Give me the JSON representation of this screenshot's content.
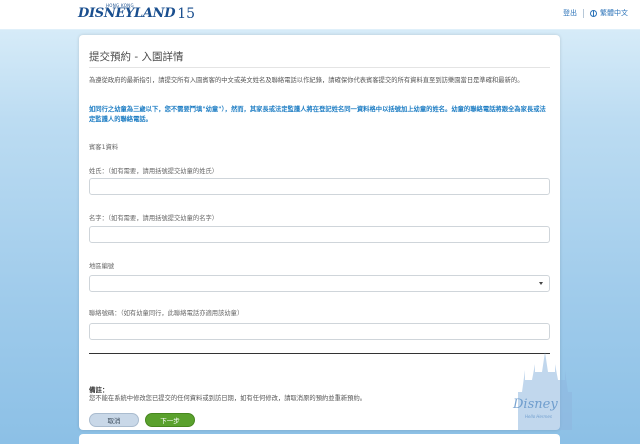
{
  "header": {
    "logo_small": "HONG KONG",
    "logo_word": "DISNEYLAND",
    "logo_num": "15",
    "logout": "登出",
    "language": "繁體中文"
  },
  "form": {
    "title": "提交預約 - 入園詳情",
    "description": "為遵從政府的最新指引，請提交所有入園賓客的中文或英文姓名及聯絡電話以作紀錄，請確保你代表賓客提交的所有資料直至到訪樂園當日是準確和最新的。",
    "warning": "如同行之幼童為三歲以下，您不需要鬥填\"幼童\"），然而，其家長或法定監護人將在登記姓名同一資料格中以括號加上幼童的姓名。幼童的聯絡電話將跟全為家長或法定監護人的聯絡電話。",
    "section": "賓客1資料",
    "surname_label": "姓氏：（如有需要，請用括號提交幼童的姓氏）",
    "surname_value": "",
    "given_label": "名字：（如有需要，請用括號提交幼童的名字）",
    "given_value": "",
    "area_code_label": "地區編號",
    "area_code_value": "",
    "phone_label": "聯絡號碼：（如有幼童同行，此聯絡電話亦適用該幼童）",
    "phone_value": "",
    "note_title": "備註：",
    "note_text": "您不能在系統中修改您已提交的任何資料或到訪日期，如有任何修改，請取消原的預約並重新預約。",
    "cancel_label": "取消",
    "next_label": "下一步"
  },
  "watermark": {
    "text": "Disney",
    "sub": "Hello Hermes"
  },
  "colors": {
    "accent": "#1f7ec4",
    "next_button": "#5aa12d",
    "cancel_button": "#c9d8e8"
  }
}
